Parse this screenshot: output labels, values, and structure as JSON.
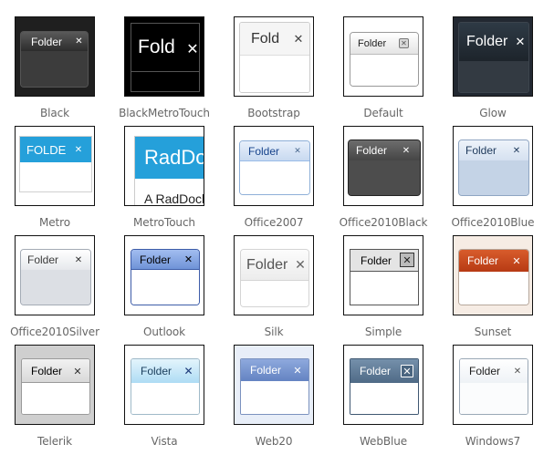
{
  "folder_label": "Folder",
  "close_glyph": "✕",
  "skins": [
    {
      "name": "Black",
      "title": "Folder"
    },
    {
      "name": "BlackMetroTouch",
      "title": "Fold"
    },
    {
      "name": "Bootstrap",
      "title": "Fold"
    },
    {
      "name": "Default",
      "title": "Folder"
    },
    {
      "name": "Glow",
      "title": "Folder"
    },
    {
      "name": "Metro",
      "title": "FOLDE"
    },
    {
      "name": "MetroTouch",
      "title": "RadDo",
      "body_text": "A RadDock"
    },
    {
      "name": "Office2007",
      "title": "Folder"
    },
    {
      "name": "Office2010Black",
      "title": "Folder"
    },
    {
      "name": "Office2010Blue",
      "title": "Folder"
    },
    {
      "name": "Office2010Silver",
      "title": "Folder"
    },
    {
      "name": "Outlook",
      "title": "Folder"
    },
    {
      "name": "Silk",
      "title": "Folder"
    },
    {
      "name": "Simple",
      "title": "Folder"
    },
    {
      "name": "Sunset",
      "title": "Folder"
    },
    {
      "name": "Telerik",
      "title": "Folder"
    },
    {
      "name": "Vista",
      "title": "Folder"
    },
    {
      "name": "Web20",
      "title": "Folder"
    },
    {
      "name": "WebBlue",
      "title": "Folder"
    },
    {
      "name": "Windows7",
      "title": "Folder"
    }
  ],
  "colors": {
    "caption": "#666666",
    "metro_accent": "#25a0da",
    "sunset_accent": "#c4441b",
    "outlook_accent": "#6f93d7",
    "web20_accent": "#6d8cc8",
    "webblue_accent": "#5a7796"
  }
}
